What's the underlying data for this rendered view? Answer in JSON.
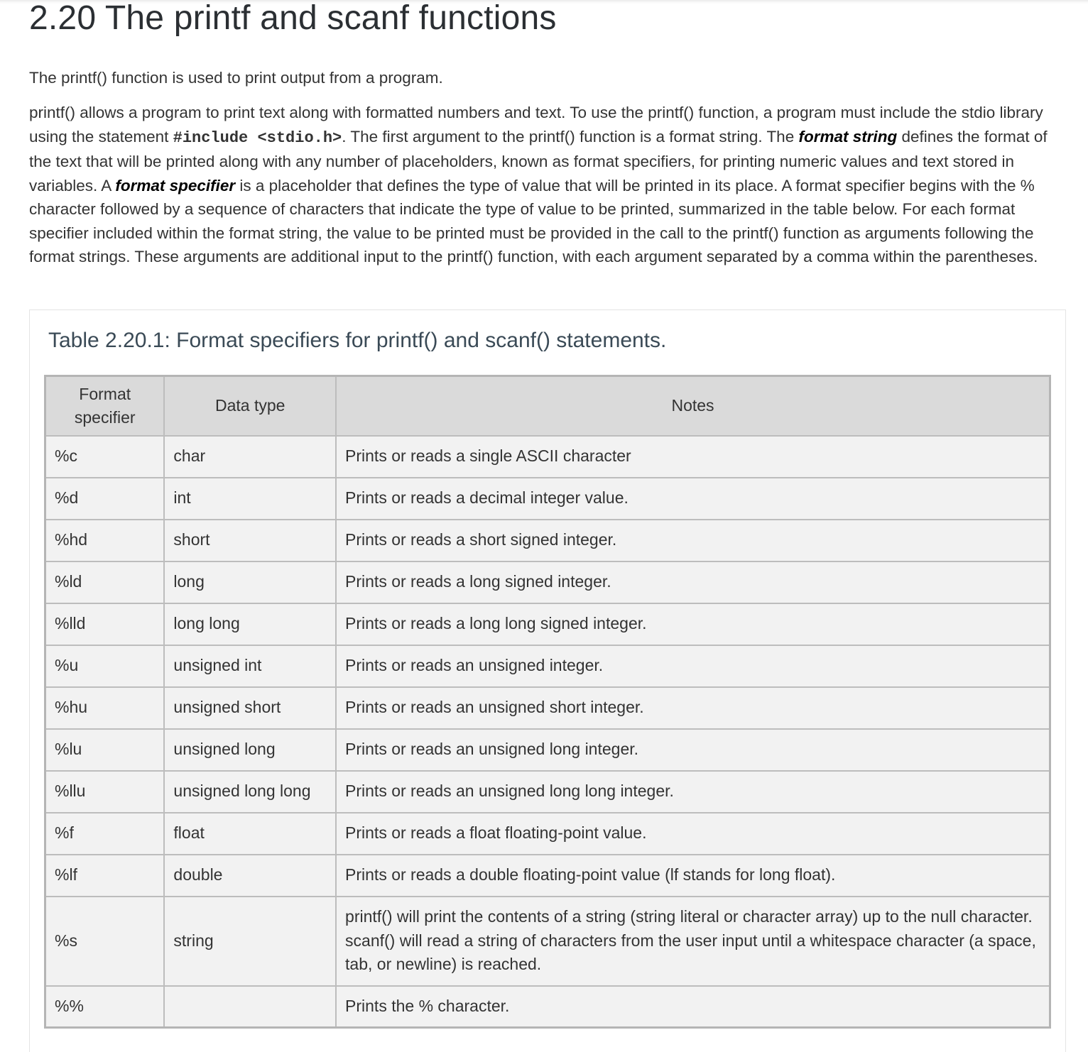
{
  "title": "2.20 The printf and scanf functions",
  "intro": "The printf() function is used to print output from a program.",
  "paragraph": {
    "p1": "printf() allows a program to print text along with formatted numbers and text. To use the printf() function, a program must include the stdio library using the statement ",
    "code": "#include <stdio.h>",
    "p2": ". The first argument to the printf() function is a format string. The ",
    "term1": "format string",
    "p3": " defines the format of the text that will be printed along with any number of placeholders, known as format specifiers, for printing numeric values and text stored in variables. A ",
    "term2": "format specifier",
    "p4": " is a placeholder that defines the type of value that will be printed in its place. A format specifier begins with the % character followed by a sequence of characters that indicate the type of value to be printed, summarized in the table below. For each format specifier included within the format string, the value to be printed must be provided in the call to the printf() function as arguments following the format strings. These arguments are additional input to the printf() function, with each argument separated by a comma within the parentheses."
  },
  "table": {
    "caption": "Table 2.20.1: Format specifiers for printf() and scanf() statements.",
    "headers": [
      "Format specifier",
      "Data type",
      "Notes"
    ],
    "rows": [
      [
        "%c",
        "char",
        "Prints or reads a single ASCII character"
      ],
      [
        "%d",
        "int",
        "Prints or reads a decimal integer value."
      ],
      [
        "%hd",
        "short",
        "Prints or reads a short signed integer."
      ],
      [
        "%ld",
        "long",
        "Prints or reads a long signed integer."
      ],
      [
        "%lld",
        "long long",
        "Prints or reads a long long signed integer."
      ],
      [
        "%u",
        "unsigned int",
        "Prints or reads an unsigned integer."
      ],
      [
        "%hu",
        "unsigned short",
        "Prints or reads an unsigned short integer."
      ],
      [
        "%lu",
        "unsigned long",
        "Prints or reads an unsigned long integer."
      ],
      [
        "%llu",
        "unsigned long long",
        "Prints or reads an unsigned long long integer."
      ],
      [
        "%f",
        "float",
        "Prints or reads a float floating-point value."
      ],
      [
        "%lf",
        "double",
        "Prints or reads a double floating-point value (lf stands for long float)."
      ],
      [
        "%s",
        "string",
        "printf() will print the contents of a string (string literal or character array) up to the null character. scanf() will read a string of characters from the user input until a whitespace character (a space, tab, or newline) is reached."
      ],
      [
        "%%",
        "",
        "Prints the % character."
      ]
    ]
  }
}
